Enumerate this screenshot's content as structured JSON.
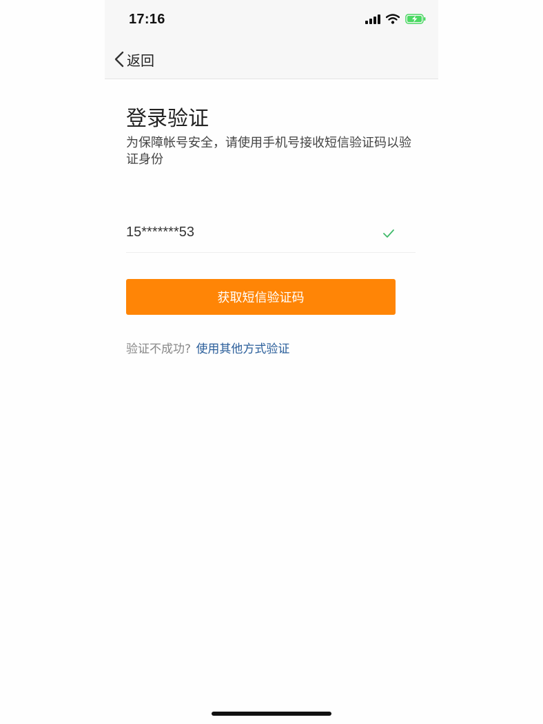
{
  "status_bar": {
    "time": "17:16",
    "icons": [
      "signal-icon",
      "wifi-icon",
      "battery-charging-icon"
    ],
    "battery_color": "#4cd964"
  },
  "nav": {
    "back_label": "返回",
    "back_icon": "chevron-left-icon"
  },
  "page": {
    "title": "登录验证",
    "description": "为保障帐号安全，请使用手机号接收短信验证码以验证身份"
  },
  "phone": {
    "value": "15*******53",
    "verified_icon": "check-icon",
    "check_color": "#3fba6a"
  },
  "actions": {
    "get_code_label": "获取短信验证码",
    "button_color": "#ff8506"
  },
  "alternative": {
    "prompt": "验证不成功?",
    "link_label": "使用其他方式验证",
    "link_color": "#2a5e9a"
  }
}
